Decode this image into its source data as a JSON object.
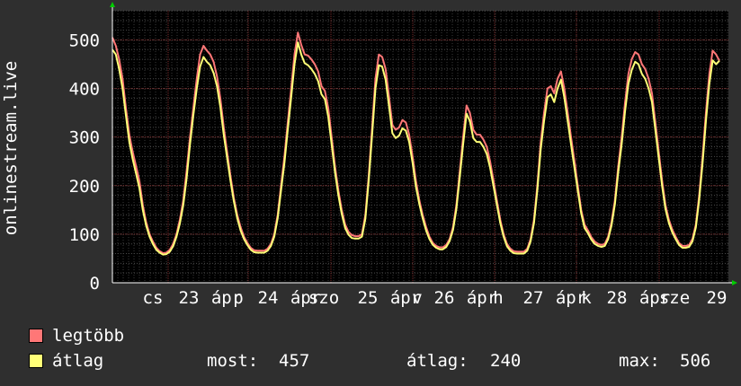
{
  "chart_data": {
    "type": "line",
    "ylabel": "onlinestream.live",
    "ylim": [
      0,
      560
    ],
    "y_ticks": [
      0,
      100,
      200,
      300,
      400,
      500
    ],
    "x_tick_labels": [
      "cs",
      "23",
      "ápr",
      "p",
      "24",
      "ápr",
      "szo",
      "25",
      "ápr",
      "v",
      "26",
      "ápr",
      "h",
      "27",
      "ápr",
      "k",
      "28",
      "ápr",
      "sze",
      "29"
    ],
    "grid": true,
    "series": [
      {
        "name": "legtöbb",
        "color": "#ff7777",
        "values": [
          505,
          488,
          460,
          420,
          360,
          305,
          270,
          240,
          210,
          160,
          125,
          100,
          85,
          72,
          65,
          61,
          62,
          68,
          80,
          100,
          130,
          170,
          230,
          300,
          360,
          420,
          470,
          488,
          478,
          470,
          455,
          425,
          380,
          320,
          270,
          220,
          175,
          140,
          115,
          95,
          82,
          72,
          67,
          66,
          66,
          66,
          70,
          80,
          100,
          140,
          200,
          260,
          330,
          400,
          470,
          515,
          490,
          470,
          468,
          460,
          450,
          435,
          405,
          395,
          360,
          300,
          240,
          190,
          150,
          120,
          105,
          98,
          96,
          96,
          100,
          140,
          220,
          320,
          420,
          470,
          465,
          440,
          385,
          325,
          315,
          320,
          335,
          330,
          305,
          260,
          210,
          170,
          140,
          115,
          95,
          82,
          76,
          73,
          73,
          78,
          90,
          115,
          160,
          230,
          300,
          365,
          350,
          315,
          305,
          305,
          295,
          280,
          250,
          210,
          170,
          130,
          100,
          80,
          70,
          65,
          64,
          64,
          64,
          70,
          90,
          130,
          200,
          290,
          350,
          400,
          405,
          390,
          420,
          435,
          400,
          350,
          300,
          250,
          200,
          150,
          120,
          108,
          94,
          85,
          80,
          78,
          80,
          95,
          125,
          170,
          240,
          300,
          370,
          430,
          460,
          475,
          470,
          450,
          440,
          420,
          390,
          330,
          270,
          210,
          160,
          130,
          110,
          95,
          82,
          76,
          76,
          78,
          90,
          120,
          180,
          260,
          350,
          430,
          478,
          470,
          457
        ]
      },
      {
        "name": "átlag",
        "color": "#ffff77",
        "values": [
          480,
          470,
          440,
          400,
          345,
          290,
          255,
          225,
          195,
          150,
          118,
          95,
          80,
          68,
          62,
          58,
          59,
          64,
          75,
          95,
          122,
          160,
          215,
          285,
          345,
          400,
          445,
          465,
          455,
          448,
          432,
          405,
          362,
          305,
          258,
          210,
          168,
          133,
          108,
          90,
          78,
          68,
          63,
          62,
          62,
          62,
          66,
          76,
          95,
          133,
          190,
          247,
          315,
          382,
          450,
          495,
          470,
          452,
          448,
          440,
          430,
          415,
          388,
          378,
          342,
          285,
          228,
          180,
          142,
          113,
          99,
          92,
          91,
          91,
          95,
          132,
          210,
          305,
          400,
          448,
          445,
          418,
          365,
          308,
          298,
          303,
          318,
          313,
          290,
          247,
          198,
          162,
          133,
          108,
          90,
          78,
          72,
          69,
          69,
          74,
          86,
          109,
          152,
          218,
          285,
          348,
          333,
          298,
          290,
          290,
          280,
          265,
          237,
          199,
          161,
          123,
          95,
          75,
          66,
          61,
          60,
          60,
          60,
          66,
          85,
          123,
          190,
          275,
          333,
          382,
          388,
          372,
          400,
          418,
          382,
          333,
          285,
          237,
          190,
          143,
          113,
          102,
          89,
          80,
          76,
          74,
          76,
          90,
          118,
          162,
          228,
          285,
          352,
          410,
          438,
          455,
          450,
          430,
          420,
          400,
          372,
          314,
          257,
          199,
          152,
          123,
          104,
          90,
          78,
          72,
          72,
          74,
          85,
          114,
          171,
          247,
          333,
          410,
          458,
          450,
          457
        ]
      }
    ],
    "stats": {
      "most_label": "most:",
      "most_value": "457",
      "avg_label": "átlag:",
      "avg_value": "240",
      "max_label": "max:",
      "max_value": "506"
    }
  }
}
